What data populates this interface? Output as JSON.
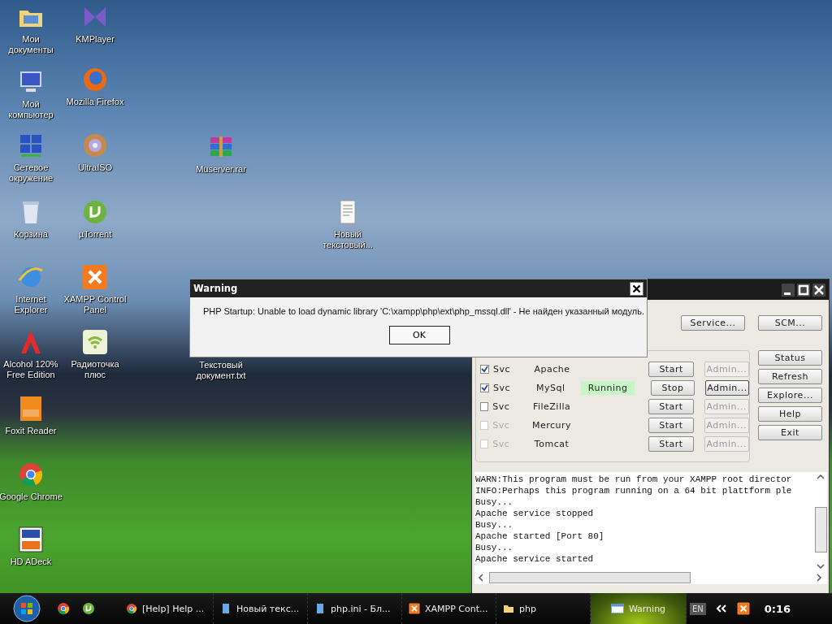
{
  "desktop_icons": [
    {
      "label": "Мои документы"
    },
    {
      "label": "KMPlayer"
    },
    {
      "label": "Мой компьютер"
    },
    {
      "label": "Mozilla Firefox"
    },
    {
      "label": "Сетевое окружение"
    },
    {
      "label": "UltraISO"
    },
    {
      "label": "Корзина"
    },
    {
      "label": "µTorrent"
    },
    {
      "label": "Internet Explorer"
    },
    {
      "label": "XAMPP Control Panel"
    },
    {
      "label": "Alcohol 120% Free Edition"
    },
    {
      "label": "Радиоточка плюс"
    },
    {
      "label": "Foxit Reader"
    },
    {
      "label": "Google Chrome"
    },
    {
      "label": "HD ADeck"
    },
    {
      "label": "Muserver.rar"
    },
    {
      "label": "Новый текстовый..."
    },
    {
      "label": "Текстовый документ.txt"
    }
  ],
  "xampp_window": {
    "top_buttons": [
      "Service...",
      "SCM..."
    ],
    "modules": [
      {
        "svc": "Svc",
        "checked": true,
        "disabled": false,
        "name": "Apache",
        "action": "Start",
        "admin": "Admin...",
        "admin_enabled": false
      },
      {
        "svc": "Svc",
        "checked": true,
        "disabled": false,
        "name": "MySql",
        "status": "Running",
        "action": "Stop",
        "admin": "Admin...",
        "admin_enabled": true
      },
      {
        "svc": "Svc",
        "checked": false,
        "disabled": false,
        "name": "FileZilla",
        "action": "Start",
        "admin": "Admin...",
        "admin_enabled": false
      },
      {
        "svc": "Svc",
        "checked": false,
        "disabled": true,
        "name": "Mercury",
        "action": "Start",
        "admin": "Admin...",
        "admin_enabled": false
      },
      {
        "svc": "Svc",
        "checked": false,
        "disabled": true,
        "name": "Tomcat",
        "action": "Start",
        "admin": "Admin...",
        "admin_enabled": false
      }
    ],
    "side_buttons": [
      "Status",
      "Refresh",
      "Explore...",
      "Help",
      "Exit"
    ],
    "log_lines": [
      "WARN:This program must be run from your XAMPP root director",
      "INFO:Perhaps this program running on a 64 bit plattform ple",
      "Busy...",
      "Apache service stopped",
      "Busy...",
      "Apache started [Port 80]",
      "Busy...",
      "Apache service started"
    ]
  },
  "dialog": {
    "title": "Warning",
    "message": "PHP Startup: Unable to load dynamic library 'C:\\xampp\\php\\ext\\php_mssql.dll' - Не найден указанный модуль.",
    "button": "OK"
  },
  "taskbar": {
    "tasks": [
      {
        "label": "[Help] Help ...",
        "selected": false
      },
      {
        "label": "Новый текс...",
        "selected": false
      },
      {
        "label": "php.ini - Бл...",
        "selected": false
      },
      {
        "label": "XAMPP Cont...",
        "selected": false
      },
      {
        "label": "php",
        "selected": false
      },
      {
        "label": "Warning",
        "selected": true
      }
    ],
    "language": "EN",
    "clock": "0:16"
  }
}
